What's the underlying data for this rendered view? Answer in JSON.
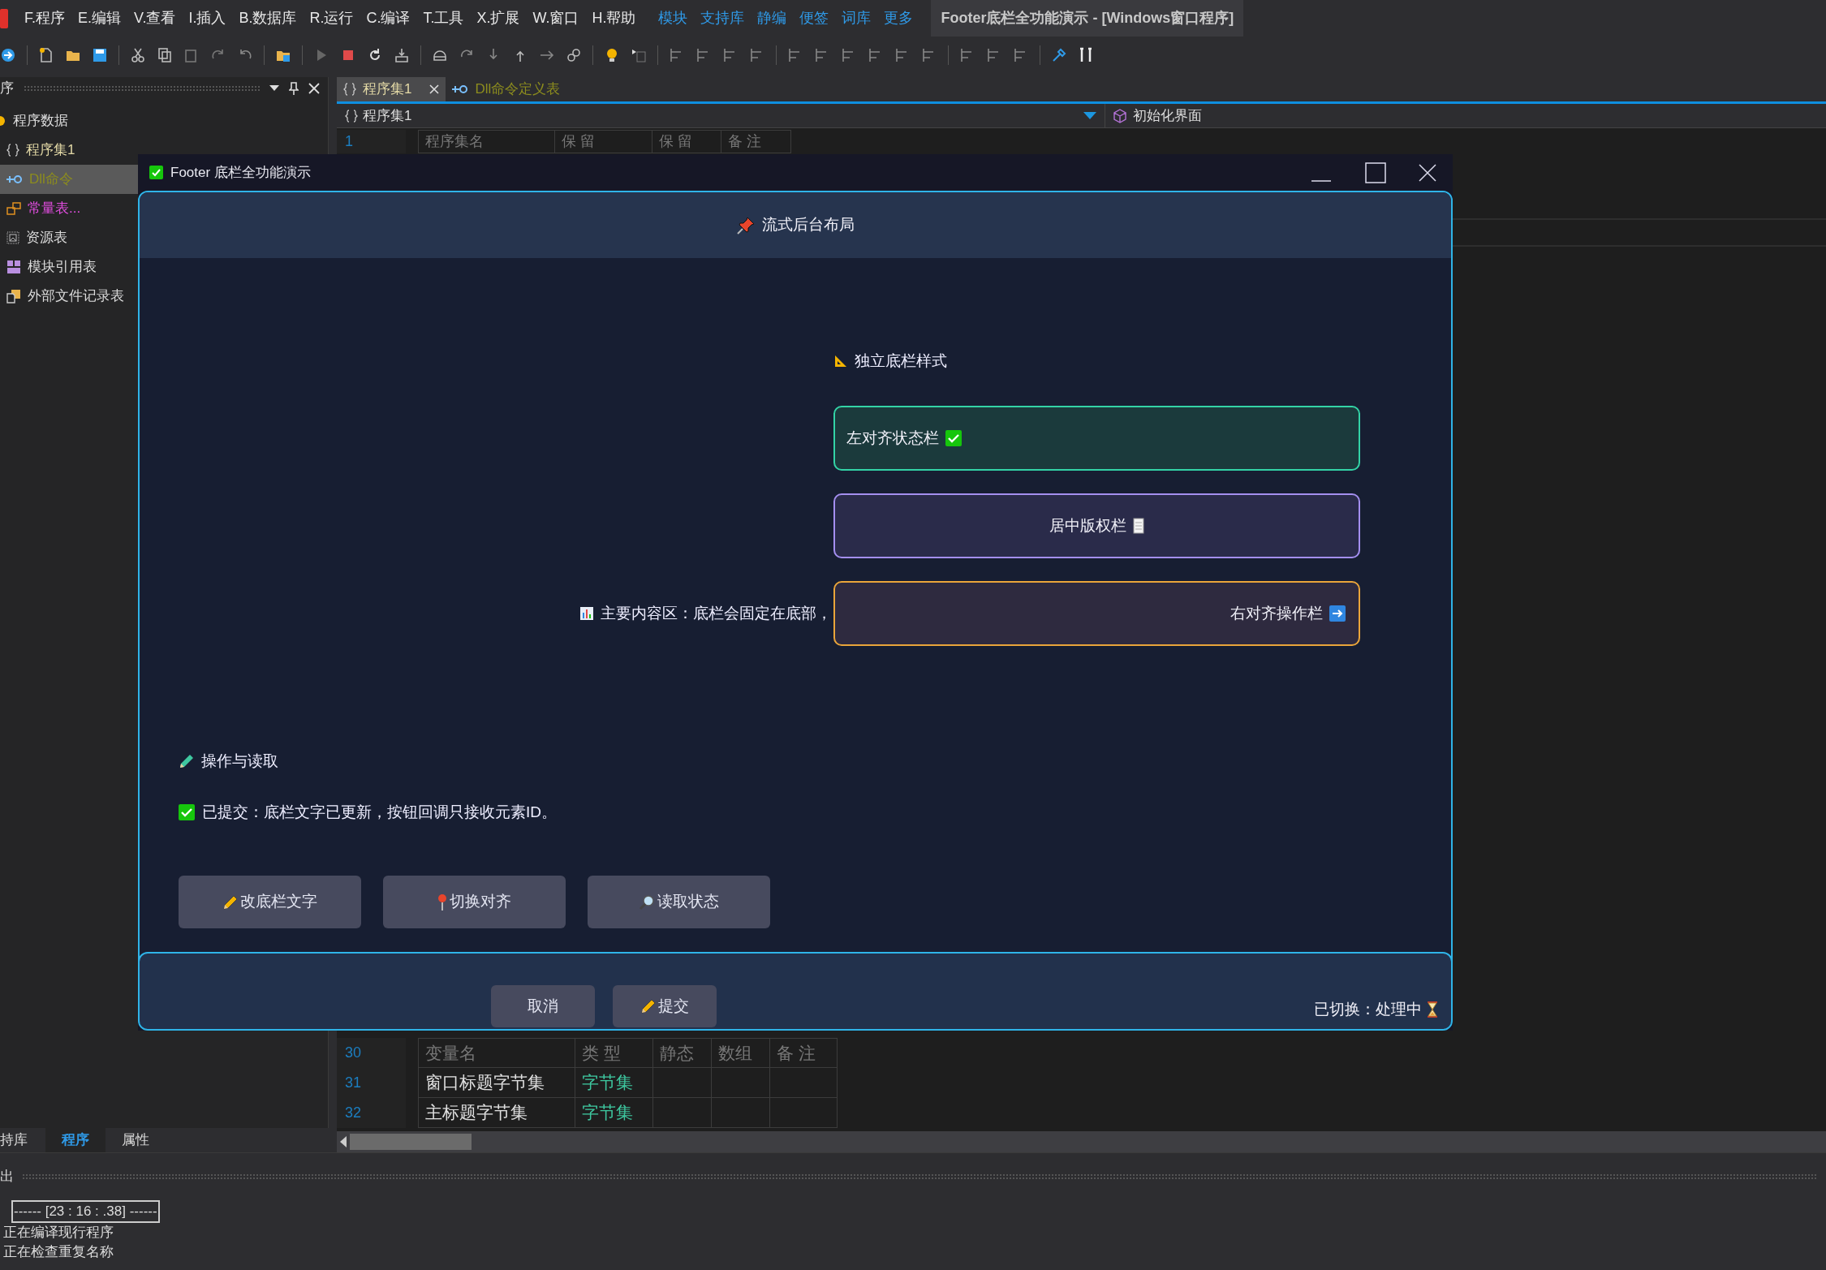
{
  "menu_bar": {
    "menus": [
      "F.程序",
      "E.编辑",
      "V.查看",
      "I.插入",
      "B.数据库",
      "R.运行",
      "C.编译",
      "T.工具",
      "X.扩展",
      "W.窗口",
      "H.帮助"
    ],
    "links": [
      "模块",
      "支持库",
      "静编",
      "便签",
      "词库",
      "更多"
    ],
    "title": "Footer底栏全功能演示 - [Windows窗口程序]"
  },
  "left_panel": {
    "title": "序",
    "tree": [
      {
        "label": "程序数据",
        "kind": "root",
        "selected": false,
        "color": "#dcdcdc",
        "children": [
          {
            "label": "程序集1",
            "kind": "braces",
            "selected": false,
            "color": "#e3d9a6"
          },
          {
            "label": "Dll命令",
            "kind": "plug",
            "selected": true,
            "color": "#8c8c1e"
          },
          {
            "label": "常量表...",
            "kind": "constants",
            "selected": false,
            "color": "#e24de0"
          },
          {
            "label": "资源表",
            "kind": "resource",
            "selected": false,
            "color": "#dcdcdc"
          },
          {
            "label": "模块引用表",
            "kind": "modules",
            "selected": false,
            "color": "#dcdcdc"
          },
          {
            "label": "外部文件记录表",
            "kind": "files",
            "selected": false,
            "color": "#dcdcdc"
          }
        ]
      }
    ],
    "tabs": [
      {
        "label": "持库",
        "selected": false
      },
      {
        "label": "程序",
        "selected": true
      },
      {
        "label": "属性",
        "selected": false
      }
    ]
  },
  "editor": {
    "tabs": [
      {
        "label": "程序集1",
        "kind": "braces",
        "selected": true
      },
      {
        "label": "Dll命令定义表",
        "kind": "plug",
        "selected": false
      }
    ],
    "breadcrumb": "程序集1",
    "method": "初始化界面",
    "top_rows": [
      {
        "line": "1",
        "kind": "header",
        "cells": [
          "程序集名",
          "保 留",
          "保 留",
          "备 注"
        ]
      }
    ],
    "bottom_rows": [
      {
        "line": "30",
        "kind": "header",
        "cells": [
          "变量名",
          "类 型",
          "静态",
          "数组",
          "备 注"
        ]
      },
      {
        "line": "31",
        "kind": "data",
        "cells": [
          "窗口标题字节集",
          "字节集"
        ]
      },
      {
        "line": "32",
        "kind": "data",
        "cells": [
          "主标题字节集",
          "字节集"
        ]
      }
    ]
  },
  "dialog": {
    "title": "Footer 底栏全功能演示",
    "header": "流式后台布局",
    "section_title": "独立底栏样式",
    "cards": [
      {
        "kind": "left",
        "label": "左对齐状态栏"
      },
      {
        "kind": "center",
        "label": "居中版权栏"
      },
      {
        "kind": "right",
        "label": "右对齐操作栏"
      }
    ],
    "main_text": "主要内容区：底栏会固定在底部，",
    "ops_title": "操作与读取",
    "status": "已提交：底栏文字已更新，按钮回调只接收元素ID。",
    "buttons": [
      {
        "kind": "pencil",
        "label": "改底栏文字"
      },
      {
        "kind": "pin",
        "label": "切换对齐"
      },
      {
        "kind": "magnifier",
        "label": "读取状态"
      }
    ],
    "footer": {
      "buttons": [
        {
          "kind": "plain",
          "label": "取消"
        },
        {
          "kind": "pencil",
          "label": "提交"
        }
      ],
      "status": "已切换：处理中"
    }
  },
  "output": {
    "title": "出",
    "lines": [
      {
        "kind": "boxed",
        "text": "------ [23 : 16 : .38] ------"
      },
      {
        "kind": "plain",
        "text": "正在编译现行程序"
      },
      {
        "kind": "plain",
        "text": "正在检查重复名称"
      }
    ]
  }
}
